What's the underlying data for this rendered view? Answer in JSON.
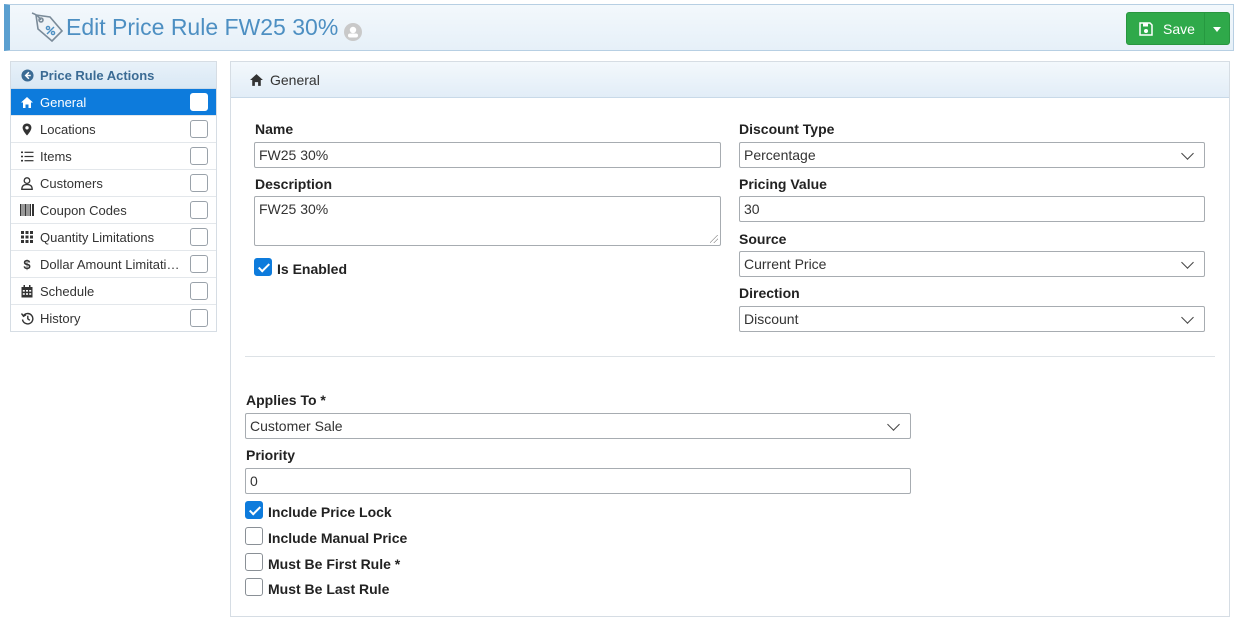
{
  "header": {
    "title": "Edit Price Rule FW25 30%",
    "save_label": "Save",
    "icons": [
      "price-tag-icon",
      "owner-icon",
      "floppy-disk-icon",
      "caret-down-icon"
    ]
  },
  "sidebar": {
    "title": "Price Rule Actions",
    "items": [
      {
        "label": "General",
        "icon": "home-icon",
        "active": true
      },
      {
        "label": "Locations",
        "icon": "map-pin-icon"
      },
      {
        "label": "Items",
        "icon": "list-icon"
      },
      {
        "label": "Customers",
        "icon": "user-icon"
      },
      {
        "label": "Coupon Codes",
        "icon": "barcode-icon"
      },
      {
        "label": "Quantity Limitations",
        "icon": "grid-icon"
      },
      {
        "label": "Dollar Amount Limitations",
        "icon": "dollar-icon"
      },
      {
        "label": "Schedule",
        "icon": "calendar-icon"
      },
      {
        "label": "History",
        "icon": "history-icon"
      }
    ]
  },
  "panel": {
    "title": "General",
    "name_label": "Name",
    "name_value": "FW25 30%",
    "description_label": "Description",
    "description_value": "FW25 30%",
    "is_enabled_label": "Is Enabled",
    "is_enabled": true,
    "discount_type_label": "Discount Type",
    "discount_type_value": "Percentage",
    "pricing_value_label": "Pricing Value",
    "pricing_value": "30",
    "source_label": "Source",
    "source_value": "Current Price",
    "direction_label": "Direction",
    "direction_value": "Discount",
    "applies_to_label": "Applies To *",
    "applies_to_value": "Customer Sale",
    "priority_label": "Priority",
    "priority_value": "0",
    "include_price_lock_label": "Include Price Lock",
    "include_price_lock": true,
    "include_manual_price_label": "Include Manual Price",
    "include_manual_price": false,
    "must_be_first_rule_label": "Must Be First Rule *",
    "must_be_first_rule": false,
    "must_be_last_rule_label": "Must Be Last Rule",
    "must_be_last_rule": false
  },
  "colors": {
    "accent": "#0d7bdc",
    "title": "#4d8fc2",
    "save": "#2fa94a"
  }
}
